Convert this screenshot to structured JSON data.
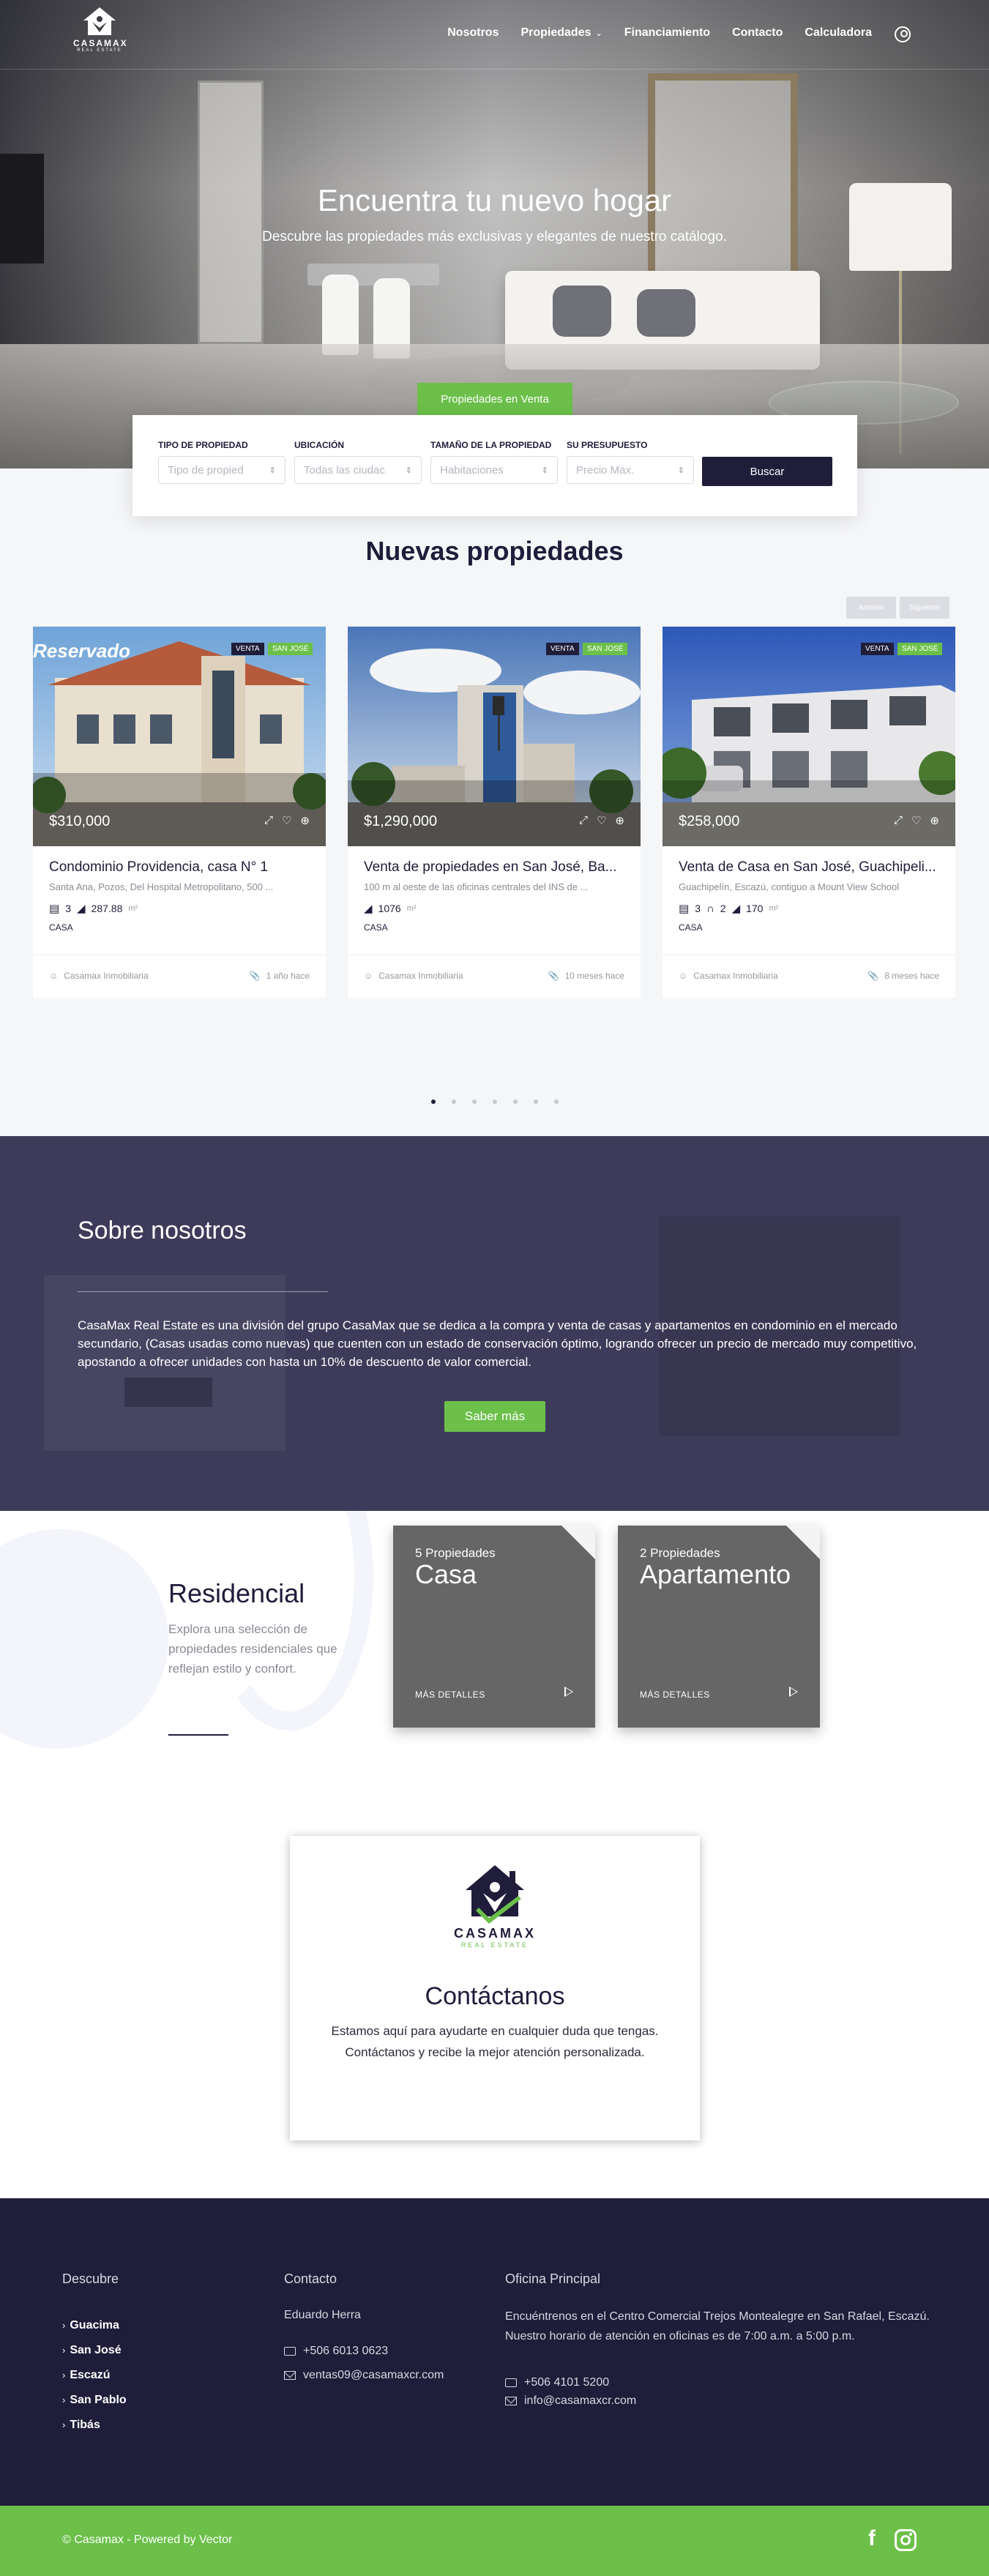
{
  "brand": {
    "name": "CASAMAX",
    "tagline": "REAL ESTATE",
    "colors": {
      "primary": "#1f1d3a",
      "accent": "#6cc04a",
      "about_bg": "#3e3b5a",
      "category_card": "#666667"
    }
  },
  "nav": {
    "items": [
      {
        "label": "Nosotros"
      },
      {
        "label": "Propiedades",
        "has_dropdown": true
      },
      {
        "label": "Financiamiento"
      },
      {
        "label": "Contacto"
      },
      {
        "label": "Calculadora"
      }
    ],
    "user_icon": "user-icon"
  },
  "hero": {
    "title": "Encuentra tu nuevo hogar",
    "subtitle": "Descubre las propiedades más exclusivas y elegantes de nuestro catálogo.",
    "tab_label": "Propiedades en Venta"
  },
  "search": {
    "fields": [
      {
        "label": "TIPO DE PROPIEDAD",
        "placeholder": "Tipo de propied"
      },
      {
        "label": "UBICACIÓN",
        "placeholder": "Todas las ciudac"
      },
      {
        "label": "TAMAÑO DE LA PROPIEDAD",
        "placeholder": "Habitaciones"
      },
      {
        "label": "SU PRESUPUESTO",
        "placeholder": "Precio Max."
      }
    ],
    "button_label": "Buscar"
  },
  "new_properties": {
    "title": "Nuevas propiedades",
    "prev_label": "Anterior",
    "next_label": "Siguiente",
    "cards": [
      {
        "overlay_text": "Reservado",
        "badges": [
          "VENTA",
          "SAN JOSÉ"
        ],
        "price": "$310,000",
        "title": "Condominio Providencia, casa N° 1",
        "address": "Santa Ana, Pozos, Del Hospital Metropolitano, 500 ...",
        "rooms": "3",
        "area": "287.88",
        "area_unit": "m²",
        "type": "CASA",
        "agent": "Casamax Inmobiliaria",
        "time": "1 año hace"
      },
      {
        "overlay_text": "",
        "badges": [
          "VENTA",
          "SAN JOSÉ"
        ],
        "price": "$1,290,000",
        "title": "Venta de propiedades en San José, Ba...",
        "address": "100 m al oeste de las oficinas centrales del INS de ...",
        "rooms": "",
        "area": "1076",
        "area_unit": "m²",
        "type": "CASA",
        "agent": "Casamax Inmobiliaria",
        "time": "10 meses hace"
      },
      {
        "overlay_text": "",
        "badges": [
          "VENTA",
          "SAN JOSÉ"
        ],
        "price": "$258,000",
        "title": "Venta de Casa en San José, Guachipeli...",
        "address": "Guachipelín, Escazú, contiguo a Mount View School",
        "rooms": "3",
        "baths": "2",
        "area": "170",
        "area_unit": "m²",
        "type": "CASA",
        "agent": "Casamax Inmobiliaria",
        "time": "8 meses hace"
      }
    ],
    "pagination": {
      "count": 7,
      "active": 1
    }
  },
  "about": {
    "title": "Sobre nosotros",
    "text": "CasaMax Real Estate es una división del grupo CasaMax que se dedica a la compra y venta de casas y apartamentos en condominio en el mercado secundario, (Casas usadas como nuevas) que cuenten con un estado de conservación óptimo, logrando ofrecer un precio de mercado muy competitivo, apostando a ofrecer unidades con hasta un 10% de descuento de valor comercial.",
    "button_label": "Saber más"
  },
  "residencial": {
    "title": "Residencial",
    "description": "Explora una selección de propiedades residenciales que reflejan estilo y confort.",
    "categories": [
      {
        "count": "5 Propiedades",
        "name": "Casa",
        "more": "MÁS DETALLES"
      },
      {
        "count": "2 Propiedades",
        "name": "Apartamento",
        "more": "MÁS DETALLES"
      }
    ]
  },
  "contact": {
    "title": "Contáctanos",
    "text": "Estamos aquí para ayudarte en cualquier duda que tengas. Contáctanos y recibe la mejor atención personalizada."
  },
  "footer": {
    "discover": {
      "title": "Descubre",
      "items": [
        "Guacima",
        "San José",
        "Escazú",
        "San Pablo",
        "Tibás"
      ]
    },
    "contact": {
      "title": "Contacto",
      "name": "Eduardo Herra",
      "phone": "+506 6013 0623",
      "email": "ventas09@casamaxcr.com"
    },
    "office": {
      "title": "Oficina Principal",
      "text": "Encuéntrenos en el Centro Comercial Trejos Montealegre en San Rafael, Escazú. Nuestro horario de atención en oficinas es de 7:00 a.m. a 5:00 p.m.",
      "phone": "+506 4101 5200",
      "email": "info@casamaxcr.com"
    },
    "copyright": "© Casamax - Powered by Vector",
    "social": [
      "facebook-icon",
      "instagram-icon"
    ]
  }
}
